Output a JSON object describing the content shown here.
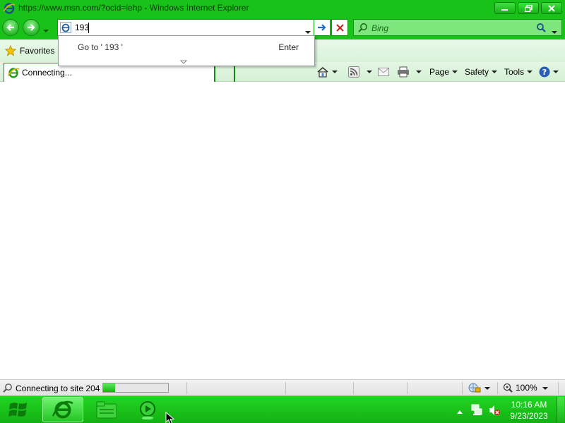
{
  "window": {
    "title": "https://www.msn.com/?ocid=iehp - Windows Internet Explorer"
  },
  "address_bar": {
    "value": "193"
  },
  "search": {
    "placeholder": "Bing"
  },
  "autocomplete": {
    "goto_text": "Go to ' 193 '",
    "hint": "Enter"
  },
  "favorites": {
    "label": "Favorites"
  },
  "tab": {
    "label": "Connecting..."
  },
  "commands": {
    "page": "Page",
    "safety": "Safety",
    "tools": "Tools"
  },
  "status": {
    "text": "Connecting to site 204",
    "progress": 0.18,
    "zoom": "100%"
  },
  "taskbar": {
    "time": "10:16 AM",
    "date": "9/23/2023"
  },
  "colors": {
    "chrome_green": "#19c219",
    "taskbar_green": "#13b013"
  }
}
